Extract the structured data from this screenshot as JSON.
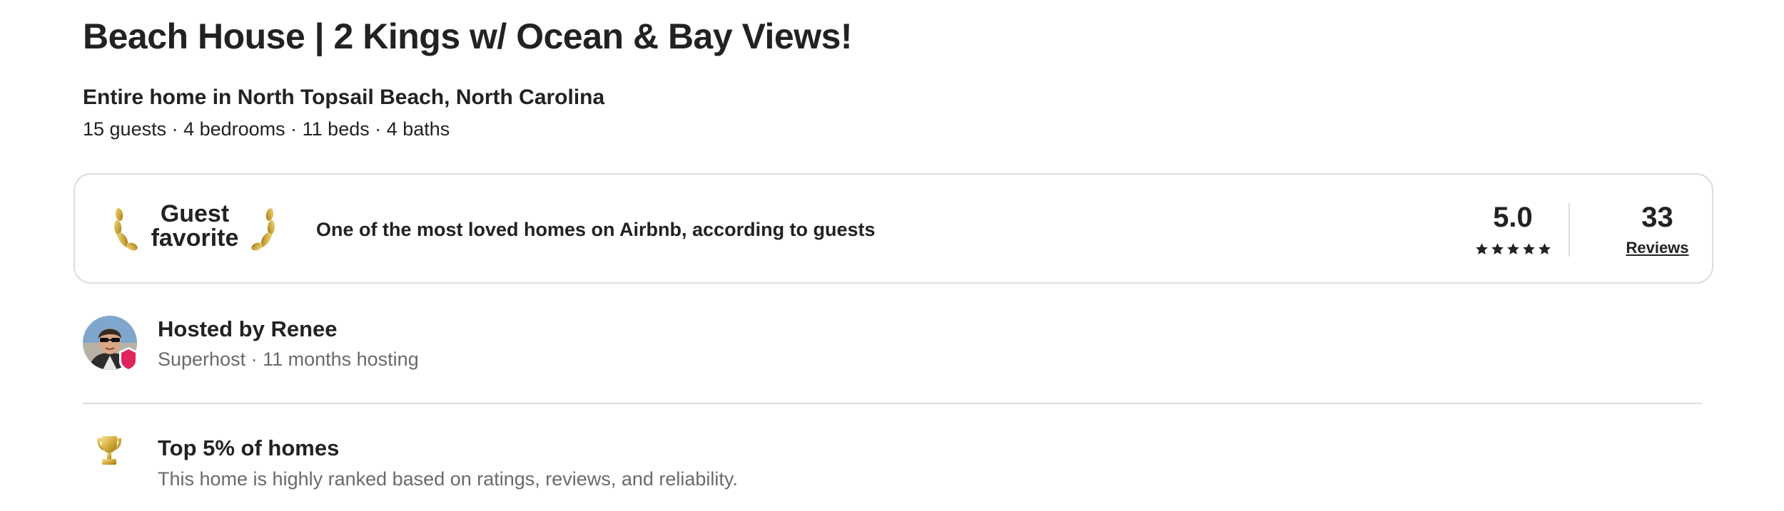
{
  "listing": {
    "title": "Beach House | 2 Kings w/ Ocean & Bay Views!",
    "property_type": "Entire home in North Topsail Beach, North Carolina",
    "stats": "15 guests · 4 bedrooms · 11 beds · 4 baths"
  },
  "guest_favorite": {
    "badge_line1": "Guest",
    "badge_line2": "favorite",
    "description": "One of the most loved homes on Airbnb, according to guests",
    "rating": "5.0",
    "stars": 5,
    "review_count": "33",
    "reviews_label": "Reviews"
  },
  "host": {
    "name_line": "Hosted by Renee",
    "meta": "Superhost · 11 months hosting"
  },
  "highlights": [
    {
      "icon": "trophy-icon",
      "title": "Top 5% of homes",
      "description": "This home is highly ranked based on ratings, reviews, and reliability."
    }
  ],
  "colors": {
    "text_primary": "#222222",
    "text_secondary": "#6a6a6a",
    "border": "#dddddd",
    "laurel_gold": "#c9a437",
    "superhost_badge": "#e0245e"
  }
}
